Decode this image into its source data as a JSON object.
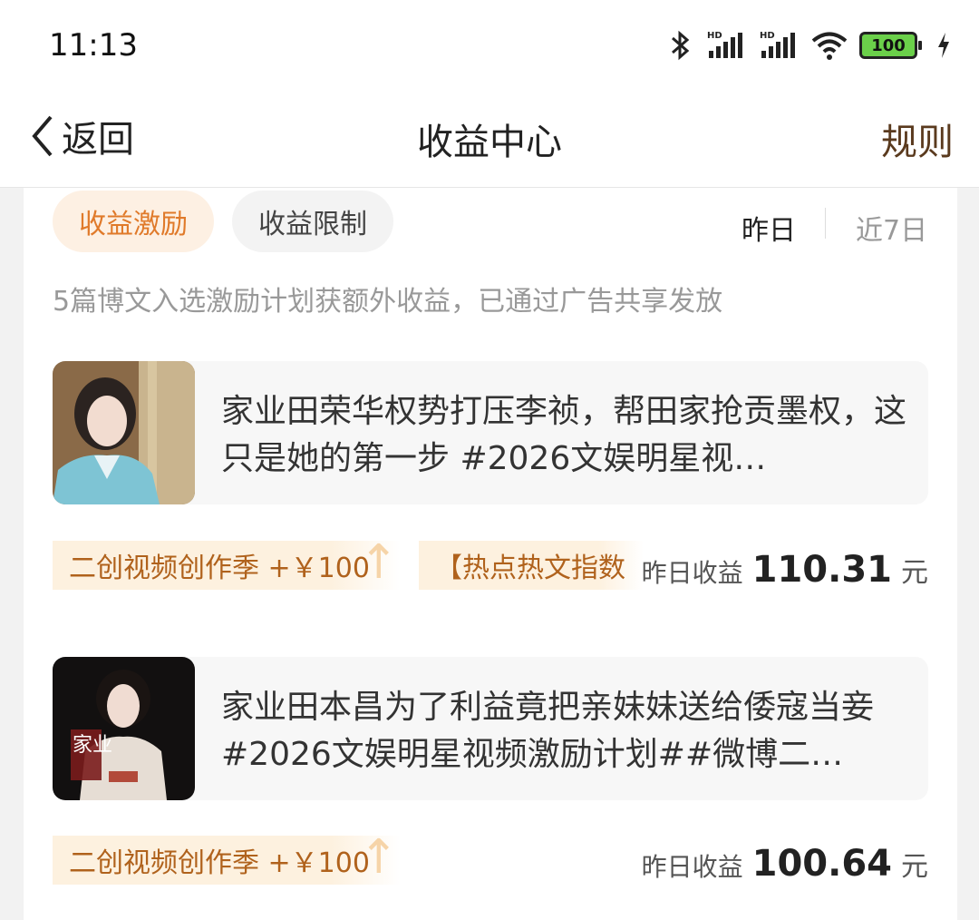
{
  "status_bar": {
    "time": "11:13",
    "battery": "100"
  },
  "nav": {
    "back_label": "返回",
    "title": "收益中心",
    "rules_label": "规则"
  },
  "tabs": {
    "active": "收益激励",
    "inactive": "收益限制"
  },
  "period": {
    "yesterday": "昨日",
    "seven_days": "近7日"
  },
  "summary": "5篇博文入选激励计划获额外收益，已通过广告共享发放",
  "posts": [
    {
      "text": "家业田荣华权势打压李祯，帮田家抢贡墨权，这只是她的第一步 #2026文娱明星视…",
      "tags": [
        "二创视频创作季 +￥100",
        "【热点热文指数"
      ],
      "earn_label": "昨日收益",
      "earn_value": "110.31",
      "earn_unit": "元"
    },
    {
      "text": "家业田本昌为了利益竟把亲妹妹送给倭寇当妾 #2026文娱明星视频激励计划##微博二…",
      "tags": [
        "二创视频创作季 +￥100"
      ],
      "earn_label": "昨日收益",
      "earn_value": "100.64",
      "earn_unit": "元",
      "thumb_text": "家业"
    }
  ],
  "colors": {
    "accent": "#e07a2a",
    "tag_text": "#b0621c",
    "tag_bg": "#fdf1df",
    "battery": "#6bd04a"
  }
}
